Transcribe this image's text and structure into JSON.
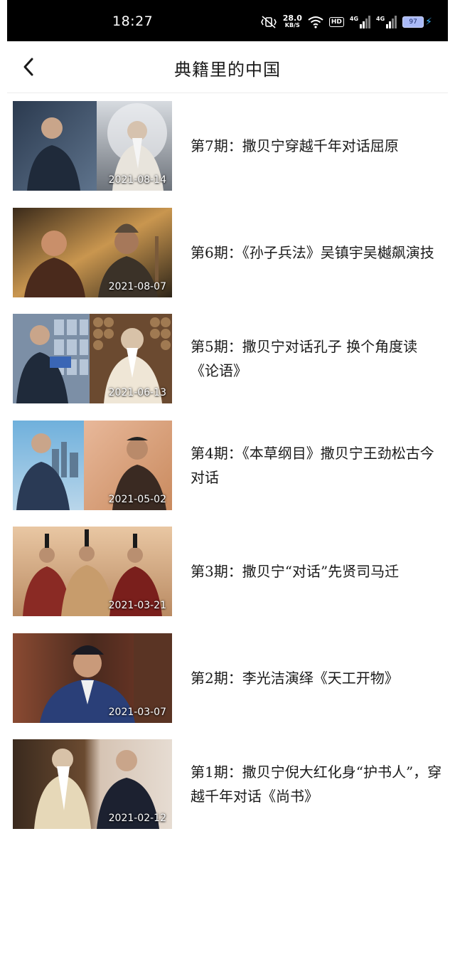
{
  "status_bar": {
    "time": "18:27",
    "net_speed": "28.0",
    "net_unit": "KB/S",
    "hd_label": "HD",
    "signal_label_1": "4G",
    "signal_label_2": "4G",
    "battery_level": "97"
  },
  "nav": {
    "title": "典籍里的中国",
    "back_icon": "chevron-left-icon"
  },
  "episodes": [
    {
      "title": "第7期：撒贝宁穿越千年对话屈原",
      "date": "2021-08-14"
    },
    {
      "title": "第6期：《孙子兵法》吴镇宇吴樾飙演技",
      "date": "2021-08-07"
    },
    {
      "title": "第5期：撒贝宁对话孔子 换个角度读《论语》",
      "date": "2021-06-13"
    },
    {
      "title": "第4期：《本草纲目》撒贝宁王劲松古今对话",
      "date": "2021-05-02"
    },
    {
      "title": "第3期：撒贝宁“对话”先贤司马迁",
      "date": "2021-03-21"
    },
    {
      "title": "第2期：李光洁演绎《天工开物》",
      "date": "2021-03-07"
    },
    {
      "title": "第1期：撒贝宁倪大红化身“护书人”，穿越千年对话《尚书》",
      "date": "2021-02-12"
    }
  ]
}
